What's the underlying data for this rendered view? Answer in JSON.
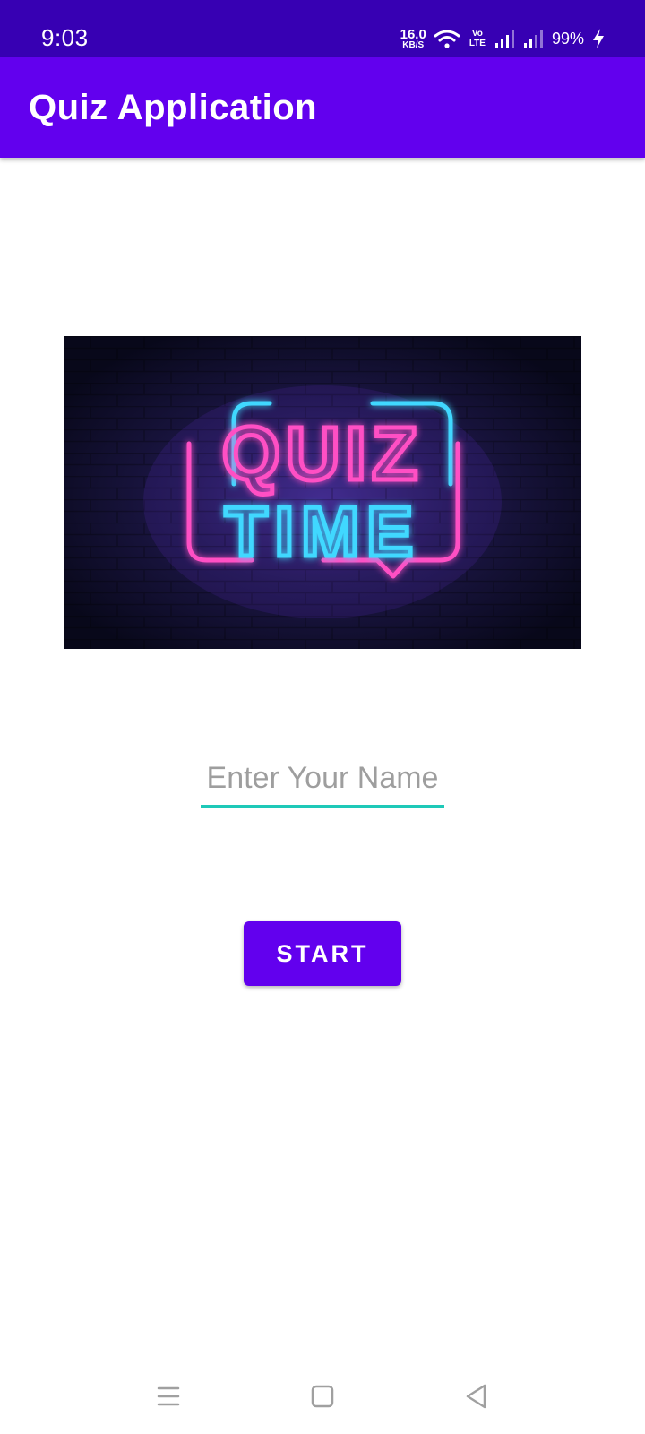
{
  "status_bar": {
    "time": "9:03",
    "net_speed_value": "16.0",
    "net_speed_unit": "KB/S",
    "volte_top": "Vo",
    "volte_bottom": "LTE",
    "battery": "99%",
    "icons": [
      "wifi-icon",
      "signal-icon",
      "signal-icon",
      "charging-icon"
    ]
  },
  "app_bar": {
    "title": "Quiz Application",
    "color": "#6200ee",
    "status_color": "#3700b3"
  },
  "hero_image": {
    "text_line1": "QUIZ",
    "text_line2": "TIME"
  },
  "name_input": {
    "placeholder": "Enter Your Name",
    "value": "",
    "underline_color": "#1ec9b8"
  },
  "start_button": {
    "label": "START",
    "color": "#6200ee"
  },
  "nav_bar": {
    "icons": [
      "menu-icon",
      "home-icon",
      "back-icon"
    ]
  }
}
